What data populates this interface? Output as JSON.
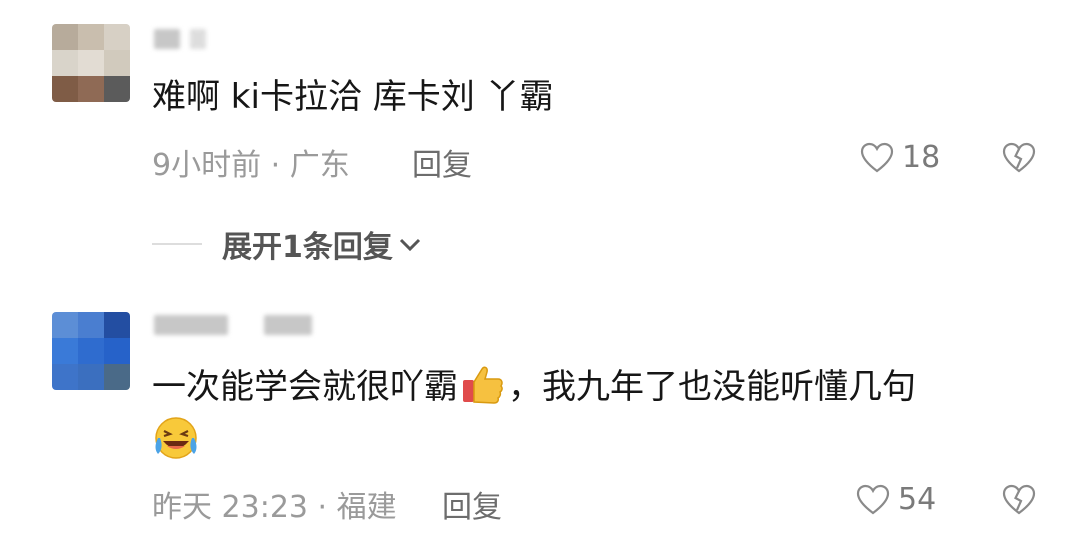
{
  "comments": [
    {
      "text": "难啊   ki卡拉洽 库卡刘 丫霸",
      "time_location": "9小时前 · 广东",
      "reply_label": "回复",
      "likes": "18",
      "expand_label": "展开1条回复"
    },
    {
      "text": "一次能学会就很吖霸",
      "text_continued": "，我九年了也没能听懂几句",
      "time_location": "昨天 23:23 · 福建",
      "reply_label": "回复",
      "likes": "54"
    }
  ],
  "icons": {
    "like": "heart-icon",
    "dislike": "broken-heart-icon",
    "expand": "chevron-down-icon",
    "emoji_thumb": "thumbs-up-emoji",
    "emoji_laugh": "laughing-crying-emoji"
  },
  "colors": {
    "meta": "#9a9a9a",
    "text": "#161616",
    "expand": "#555555"
  }
}
